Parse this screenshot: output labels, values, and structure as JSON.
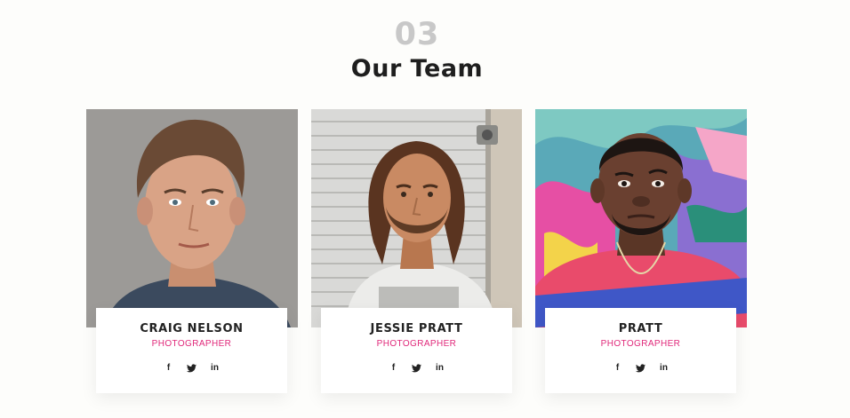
{
  "section": {
    "number": "03",
    "title": "Our Team"
  },
  "team": [
    {
      "name": "CRAIG NELSON",
      "role": "PHOTOGRAPHER",
      "socials": {
        "facebook": "f",
        "linkedin": "in"
      }
    },
    {
      "name": "JESSIE PRATT",
      "role": "PHOTOGRAPHER",
      "socials": {
        "facebook": "f",
        "linkedin": "in"
      }
    },
    {
      "name": "PRATT",
      "role": "PHOTOGRAPHER",
      "socials": {
        "facebook": "f",
        "linkedin": "in"
      }
    }
  ],
  "colors": {
    "accent": "#e0287a",
    "number": "#c8c8c8",
    "title": "#1e1e1e"
  },
  "icons": [
    "facebook-icon",
    "twitter-icon",
    "linkedin-icon"
  ]
}
